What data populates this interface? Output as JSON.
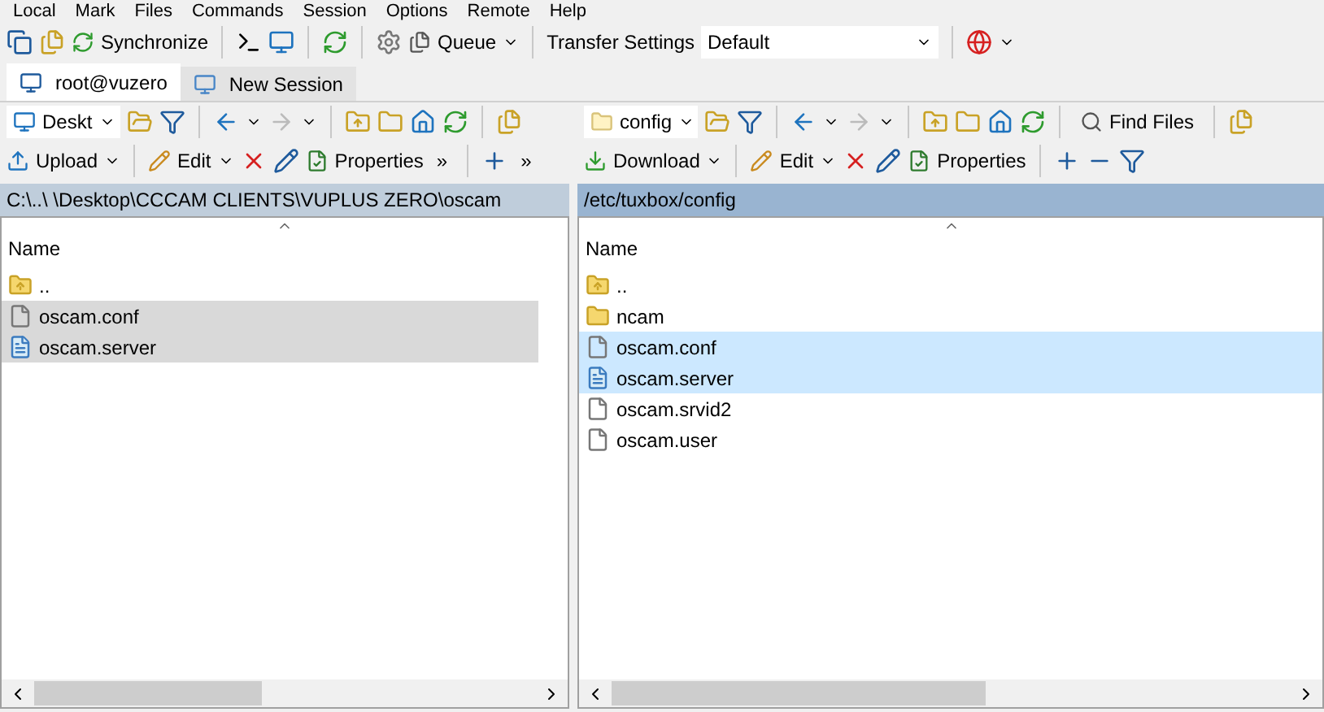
{
  "menu": [
    "Local",
    "Mark",
    "Files",
    "Commands",
    "Session",
    "Options",
    "Remote",
    "Help"
  ],
  "toolbar": {
    "synchronize": "Synchronize",
    "queue": "Queue",
    "transfer_label": "Transfer Settings",
    "transfer_value": "Default"
  },
  "tabs": [
    {
      "label": "root@vuzero",
      "selected": true,
      "kind": "session"
    },
    {
      "label": "New Session",
      "selected": false,
      "kind": "new"
    }
  ],
  "panels": [
    {
      "active": false,
      "location": "Deskt",
      "path": "C:\\..\\        \\Desktop\\CCCAM CLIENTS\\VUPLUS ZERO\\oscam",
      "action": "Upload",
      "edit": "Edit",
      "properties": "Properties",
      "more": "»",
      "column": "Name",
      "files": [
        {
          "name": "..",
          "kind": "up",
          "selected": false
        },
        {
          "name": "oscam.conf",
          "kind": "file",
          "selected": true
        },
        {
          "name": "oscam.server",
          "kind": "text",
          "selected": true
        }
      ]
    },
    {
      "active": true,
      "location": "config",
      "path": "/etc/tuxbox/config",
      "action": "Download",
      "edit": "Edit",
      "properties": "Properties",
      "find": "Find Files",
      "column": "Name",
      "files": [
        {
          "name": "..",
          "kind": "up",
          "selected": false
        },
        {
          "name": "ncam",
          "kind": "folder",
          "selected": false
        },
        {
          "name": "oscam.conf",
          "kind": "file",
          "selected": true
        },
        {
          "name": "oscam.server",
          "kind": "text",
          "selected": true
        },
        {
          "name": "oscam.srvid2",
          "kind": "file",
          "selected": false
        },
        {
          "name": "oscam.user",
          "kind": "file",
          "selected": false
        }
      ]
    }
  ]
}
